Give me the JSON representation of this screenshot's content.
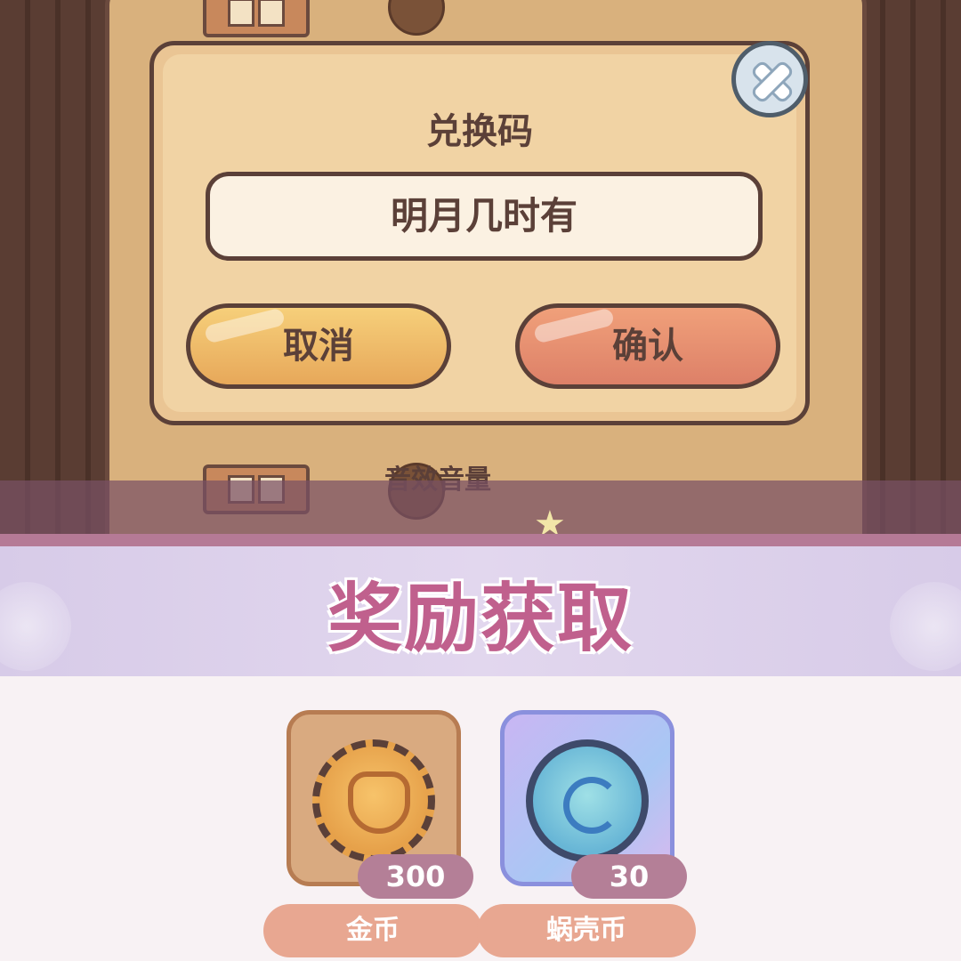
{
  "dialog": {
    "title": "兑换码",
    "code_value": "明月几时有",
    "cancel_label": "取消",
    "confirm_label": "确认"
  },
  "settings": {
    "peek_label": "音效音量"
  },
  "reward": {
    "title": "奖励获取",
    "items": [
      {
        "name": "金币",
        "count": "300",
        "icon": "gold-coin-icon"
      },
      {
        "name": "蜗壳币",
        "count": "30",
        "icon": "snail-shell-coin-icon"
      }
    ]
  },
  "colors": {
    "dialog_bg": "#f1d3a4",
    "cancel_button": "#e7a85a",
    "confirm_button": "#dd8068",
    "reward_title": "#c0608d",
    "name_pill": "#e8a791",
    "count_badge": "#b47f97"
  }
}
